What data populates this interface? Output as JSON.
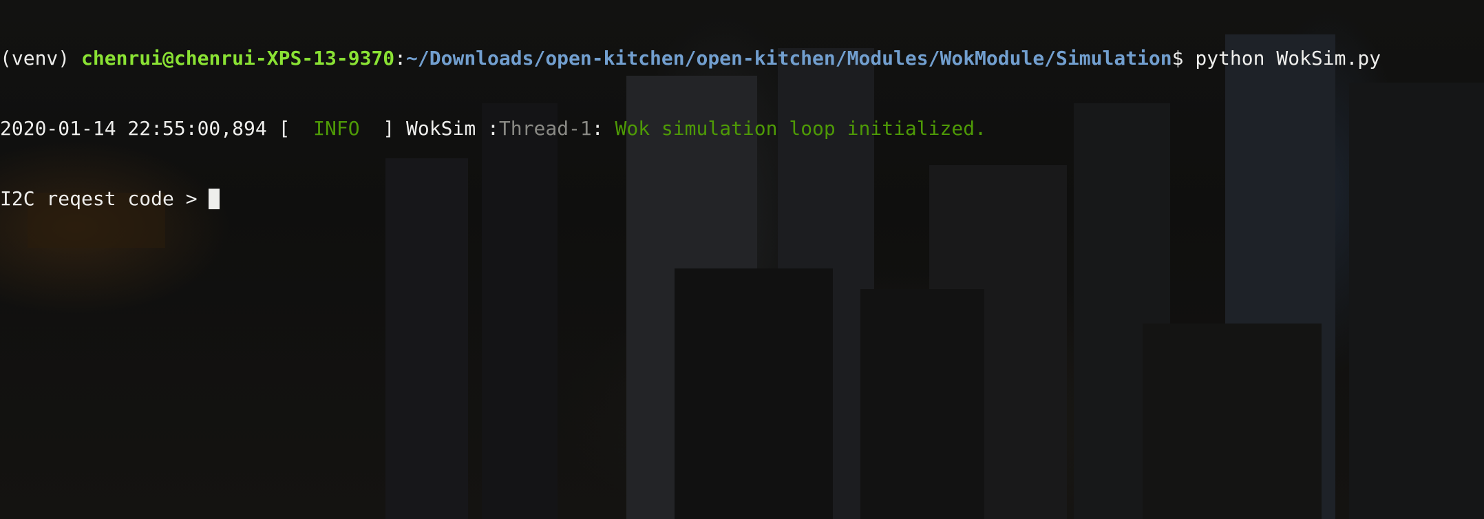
{
  "terminal": {
    "colors": {
      "background": "#0d0d0c",
      "foreground": "#eeeeec",
      "user_host": "#8ae234",
      "path": "#729fcf",
      "info": "#4e9a06",
      "thread": "#8a8a85"
    },
    "command_line": {
      "venv": "(venv) ",
      "user_host": "chenrui@chenrui-XPS-13-9370",
      "separator": ":",
      "path": "~/Downloads/open-kitchen/open-kitchen/Modules/WokModule/Simulation",
      "prompt_symbol": "$ ",
      "command": "python WokSim.py"
    },
    "log_line": {
      "timestamp": "2020-01-14 22:55:00,894",
      "bracket_open": " [  ",
      "level": "INFO",
      "bracket_close": "  ] ",
      "logger": "WokSim :",
      "thread": "Thread-1",
      "thread_sep": ": ",
      "message": "Wok simulation loop initialized."
    },
    "input_line": {
      "prompt": "I2C reqest code > "
    }
  }
}
